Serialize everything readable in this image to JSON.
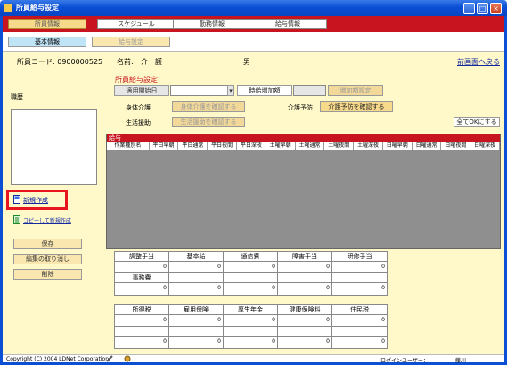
{
  "window": {
    "title": "所員給与設定"
  },
  "topnav": {
    "tabs": [
      {
        "label": "所員情報",
        "active": true
      },
      {
        "label": "スケジュール",
        "active": false
      },
      {
        "label": "勤務情報",
        "active": false
      },
      {
        "label": "給与情報",
        "active": false
      }
    ]
  },
  "subtabs": [
    {
      "label": "基本情報",
      "active": true
    },
    {
      "label": "給与設定",
      "active": false
    }
  ],
  "info": {
    "code_label": "所員コード: 0900000525",
    "name_label": "名前:",
    "name_value": "介　護",
    "gender": "男",
    "back_link": "前画面へ戻る"
  },
  "left": {
    "history_label": "職歴",
    "new_link": "新規作成",
    "copy_link": "コピーして新規作成",
    "save": "保存",
    "cancel": "編集の取り消し",
    "delete": "削除"
  },
  "main": {
    "title": "所員給与設定",
    "start_date_btn": "適用開始日",
    "hourly_btn": "時給増加額",
    "add_setting_btn": "増加額設定",
    "body_care_label": "身体介護",
    "body_care_btn": "身体介護を確認する",
    "prevention_label": "介護予防",
    "prevention_btn": "介護予防を確認する",
    "life_label": "生活援助",
    "life_btn": "生活援助を確認する",
    "all_ok_btn": "全てOKにする"
  },
  "grid": {
    "title": "給与",
    "columns": [
      "作業種別名",
      "平日早朝",
      "平日通常",
      "平日夜間",
      "平日深夜",
      "土曜早朝",
      "土曜通常",
      "土曜夜間",
      "土曜深夜",
      "日曜早朝",
      "日曜通常",
      "日曜夜間",
      "日曜深夜"
    ]
  },
  "allowances": {
    "headers": [
      "調整手当",
      "基本給",
      "通信費",
      "障害手当",
      "研修手当"
    ],
    "headers2": [
      "事務費"
    ],
    "deductions": [
      "所得税",
      "雇用保険",
      "厚生年金",
      "健康保険料",
      "住民税"
    ],
    "zero": "0"
  },
  "status": {
    "copyright": "Copyright (C) 2004 LDNet Corporation",
    "login_label": "ログインユーザー：",
    "login_user": "藤川"
  }
}
